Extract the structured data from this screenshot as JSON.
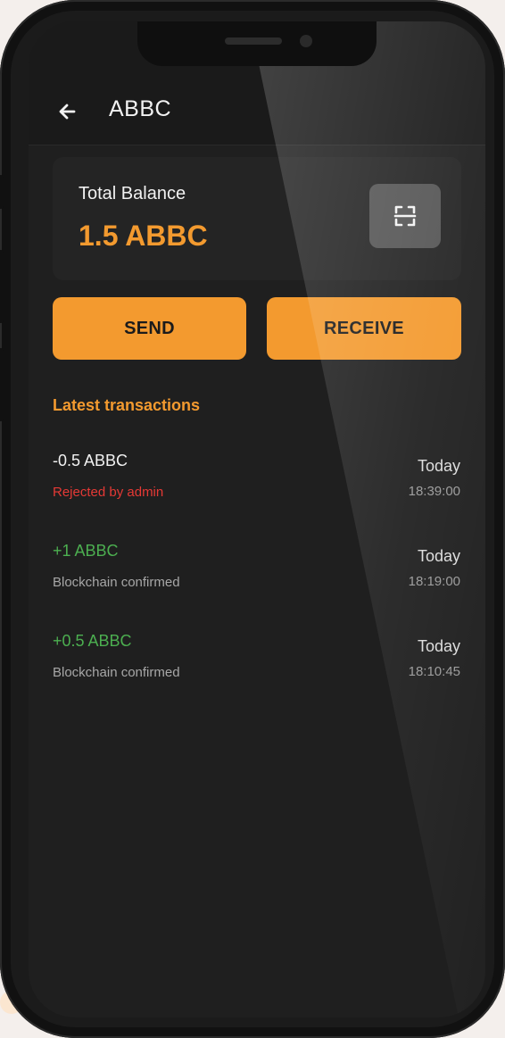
{
  "header": {
    "title": "ABBC"
  },
  "balance": {
    "label": "Total Balance",
    "value": "1.5 ABBC"
  },
  "actions": {
    "send_label": "SEND",
    "receive_label": "RECEIVE"
  },
  "transactions": {
    "section_title": "Latest transactions",
    "items": [
      {
        "amount": "-0.5 ABBC",
        "status": "Rejected by admin",
        "day": "Today",
        "time": "18:39:00"
      },
      {
        "amount": "+1 ABBC",
        "status": "Blockchain confirmed",
        "day": "Today",
        "time": "18:19:00"
      },
      {
        "amount": "+0.5 ABBC",
        "status": "Blockchain confirmed",
        "day": "Today",
        "time": "18:10:45"
      }
    ]
  },
  "colors": {
    "accent": "#f39a2f",
    "negative": "#e53935",
    "positive": "#4caf50",
    "text": "#f1f1f1",
    "muted": "#9a9a9a"
  },
  "icons": {
    "back": "back-arrow-icon",
    "scan": "scan-icon"
  }
}
